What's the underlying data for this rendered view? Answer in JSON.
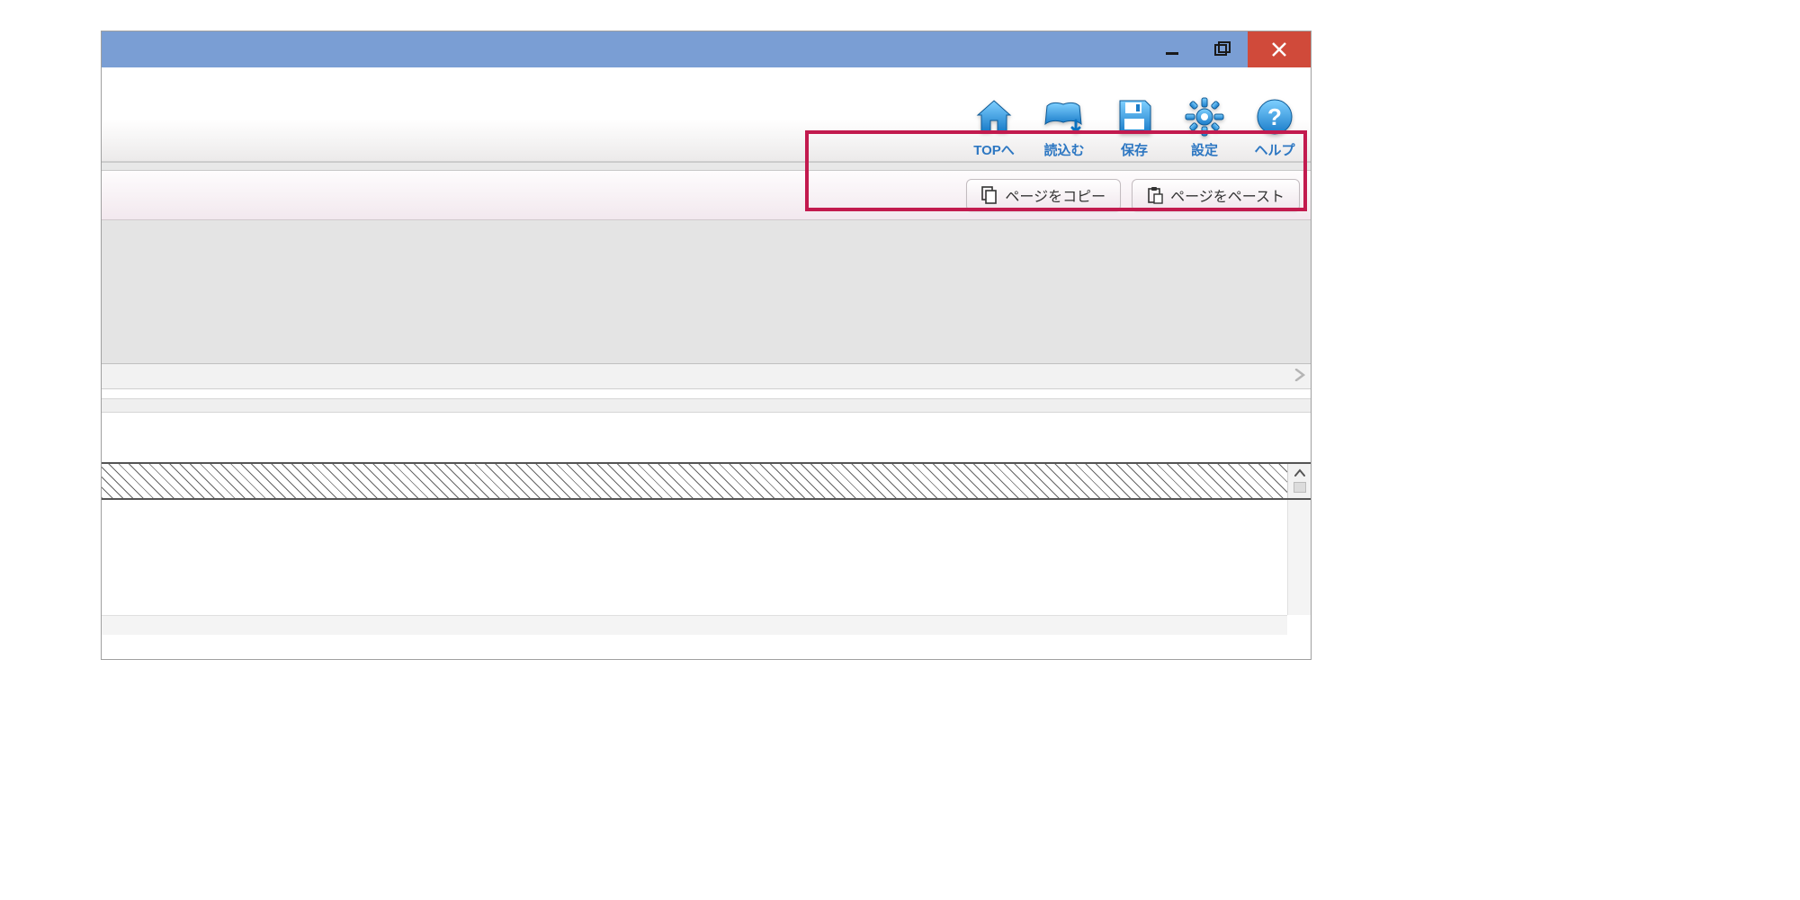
{
  "window_controls": {
    "minimize": "minimize",
    "maximize": "maximize",
    "close": "close"
  },
  "toolbar": {
    "top": {
      "label": "TOPへ"
    },
    "load": {
      "label": "読込む"
    },
    "save": {
      "label": "保存"
    },
    "settings": {
      "label": "設定"
    },
    "help": {
      "label": "ヘルプ"
    }
  },
  "page_actions": {
    "copy_label": "ページをコピー",
    "paste_label": "ページをペースト"
  }
}
